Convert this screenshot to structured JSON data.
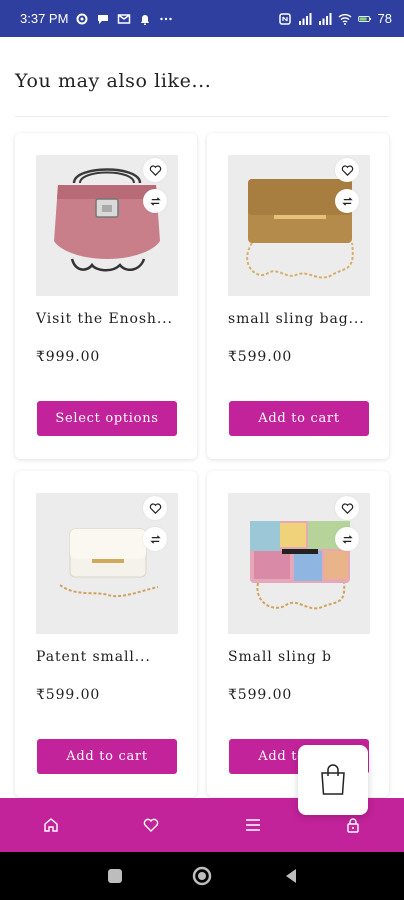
{
  "status_bar": {
    "time": "3:37 PM",
    "battery": "78",
    "left_icons": [
      "settings-icon",
      "chat-icon",
      "gmail-icon",
      "notification-icon",
      "more-icon"
    ],
    "right_icons": [
      "nfc-icon",
      "signal-icon",
      "signal-icon",
      "wifi-icon",
      "battery-icon"
    ]
  },
  "section": {
    "title": "You may also like..."
  },
  "products": [
    {
      "name": "Visit the Enosh...",
      "price": "₹999.00",
      "action": "Select options",
      "image_icon": "pink-chain-bag-image"
    },
    {
      "name": "small sling bag...",
      "price": "₹599.00",
      "action": "Add to cart",
      "image_icon": "gold-clutch-image"
    },
    {
      "name": "Patent small...",
      "price": "₹599.00",
      "action": "Add to cart",
      "image_icon": "white-clutch-image"
    },
    {
      "name": "Small sling b",
      "price": "₹599.00",
      "action": "Add to cart",
      "image_icon": "multicolor-bag-image"
    }
  ],
  "bottom_nav": {
    "items": [
      "home-icon",
      "heart-icon",
      "menu-icon",
      "lock-icon"
    ]
  },
  "floating_cart": {
    "icon": "shopping-bag-icon"
  },
  "colors": {
    "accent": "#c2229a",
    "status_bar": "#2f3f9f",
    "system_nav": "#000000"
  }
}
